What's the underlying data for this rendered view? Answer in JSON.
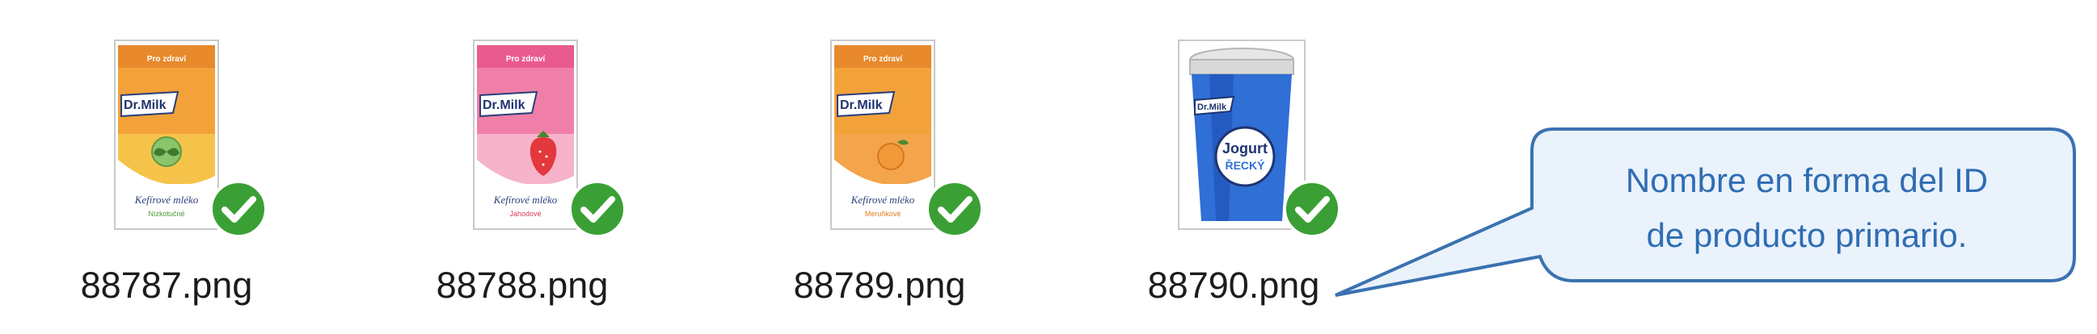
{
  "files": [
    {
      "name": "88787.png",
      "icon": "kefir-carton-mint-icon",
      "kind": "carton",
      "top_color": "#f3a23a",
      "bottom_color": "#f6c34a",
      "band_color": "#e8892c",
      "band_text": "Pro zdraví",
      "brand": "Dr.Milk",
      "script_text": "Kefírové mléko",
      "variant": "Nízkotučné",
      "variant_color": "#4a9a3a",
      "status": "checkmark-icon"
    },
    {
      "name": "88788.png",
      "icon": "kefir-carton-strawberry-icon",
      "kind": "carton",
      "top_color": "#ef7fa8",
      "bottom_color": "#f6b3c9",
      "band_color": "#e95b8e",
      "band_text": "Pro zdraví",
      "brand": "Dr.Milk",
      "script_text": "Kefírové mléko",
      "variant": "Jahodové",
      "variant_color": "#d33a5a",
      "status": "checkmark-icon"
    },
    {
      "name": "88789.png",
      "icon": "kefir-carton-apricot-icon",
      "kind": "carton",
      "top_color": "#f3a23a",
      "bottom_color": "#f4a44a",
      "band_color": "#e8892c",
      "band_text": "Pro zdraví",
      "brand": "Dr.Milk",
      "script_text": "Kefírové mléko",
      "variant": "Meruňkové",
      "variant_color": "#e37a1c",
      "status": "checkmark-icon"
    },
    {
      "name": "88790.png",
      "icon": "greek-yogurt-cup-icon",
      "kind": "cup",
      "brand": "Dr.Milk",
      "cup_label_line1": "Jogurt",
      "cup_label_line2": "ŘECKÝ",
      "status": "checkmark-icon"
    }
  ],
  "callout": {
    "line1": "Nombre en forma del ID",
    "line2": "de producto primario.",
    "border_color": "#3a72b0",
    "fill_color": "#eaf2fb",
    "text_color": "#2f6db3"
  },
  "colors": {
    "check_green": "#3aa035",
    "filename_text": "#1c1c1c"
  }
}
